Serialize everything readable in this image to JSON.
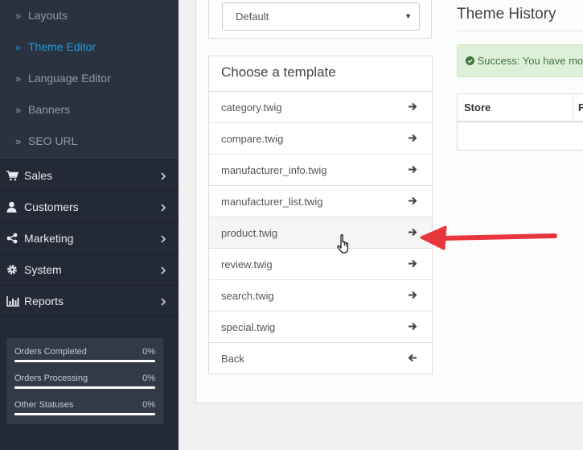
{
  "sidebar": {
    "sub_items": [
      {
        "label": "Layouts"
      },
      {
        "label": "Theme Editor"
      },
      {
        "label": "Language Editor"
      },
      {
        "label": "Banners"
      },
      {
        "label": "SEO URL"
      }
    ],
    "menu": [
      {
        "label": "Sales",
        "icon": "shopping-cart-icon"
      },
      {
        "label": "Customers",
        "icon": "user-icon"
      },
      {
        "label": "Marketing",
        "icon": "share-icon"
      },
      {
        "label": "System",
        "icon": "gear-icon"
      },
      {
        "label": "Reports",
        "icon": "bar-chart-icon"
      }
    ],
    "stats": [
      {
        "label": "Orders Completed",
        "percent": "0%",
        "value": 0
      },
      {
        "label": "Orders Processing",
        "percent": "0%",
        "value": 0
      },
      {
        "label": "Other Statuses",
        "percent": "0%",
        "value": 0
      }
    ]
  },
  "store_select": {
    "value": "Default"
  },
  "template_panel": {
    "heading": "Choose a template",
    "items": [
      {
        "label": "category.twig",
        "icon": "arrow-right-icon"
      },
      {
        "label": "compare.twig",
        "icon": "arrow-right-icon"
      },
      {
        "label": "manufacturer_info.twig",
        "icon": "arrow-right-icon"
      },
      {
        "label": "manufacturer_list.twig",
        "icon": "arrow-right-icon"
      },
      {
        "label": "product.twig",
        "icon": "arrow-right-icon"
      },
      {
        "label": "review.twig",
        "icon": "arrow-right-icon"
      },
      {
        "label": "search.twig",
        "icon": "arrow-right-icon"
      },
      {
        "label": "special.twig",
        "icon": "arrow-right-icon"
      },
      {
        "label": "Back",
        "icon": "arrow-left-icon"
      }
    ]
  },
  "history": {
    "title": "Theme History",
    "alert": "Success: You have mo",
    "columns": [
      "Store",
      "F"
    ]
  },
  "colors": {
    "sidebar_bg": "#242a35",
    "active_link": "#1f9bd8",
    "alert_bg": "#dff0d8",
    "annotation_arrow": "#e8363c"
  }
}
